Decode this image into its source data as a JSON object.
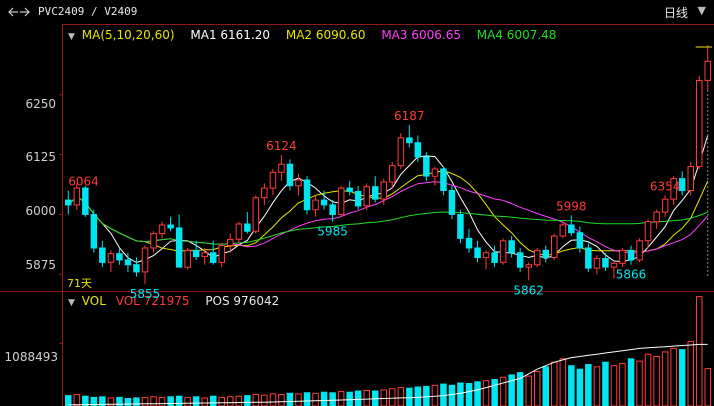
{
  "header": {
    "symbol": "PVC2409 / V2409",
    "period": "日线",
    "period_arrow": "▼"
  },
  "ma_legend": {
    "marker": "▼",
    "params": "MA(5,10,20,60)",
    "ma1": "MA1 6161.20",
    "ma2": "MA2 6090.60",
    "ma3": "MA3 6006.65",
    "ma4": "MA4 6007.48"
  },
  "vol_legend": {
    "marker": "▼",
    "name": "VOL",
    "vol": "VOL 721975",
    "pos": "POS 976042"
  },
  "colors": {
    "up": "#ff3a3a",
    "down": "#00e5f0",
    "ma1": "#ffffff",
    "ma2": "#e6e600",
    "ma3": "#ff40ff",
    "ma4": "#22dd22",
    "axis": "#8a1c1c"
  },
  "chart_data": [
    {
      "type": "candlestick",
      "y_ticks": [
        "6250",
        "6125",
        "6000",
        "5875"
      ],
      "y_tick_values": [
        6250,
        6125,
        6000,
        5875
      ],
      "ylim": [
        5838,
        6398
      ],
      "bar_count": 71,
      "bar_count_label": "71天",
      "annotations": [
        {
          "label": "6064",
          "index": 0,
          "kind": "high"
        },
        {
          "label": "5855",
          "index": 9,
          "kind": "low"
        },
        {
          "label": "6124",
          "index": 25,
          "kind": "high"
        },
        {
          "label": "5985",
          "index": 31,
          "kind": "low"
        },
        {
          "label": "6187",
          "index": 40,
          "kind": "high"
        },
        {
          "label": "5862",
          "index": 54,
          "kind": "low"
        },
        {
          "label": "5998",
          "index": 59,
          "kind": "high"
        },
        {
          "label": "5866",
          "index": 66,
          "kind": "low"
        },
        {
          "label": "6354",
          "index": 70,
          "kind": "high"
        }
      ],
      "candles": [
        [
          6030,
          6050,
          6000,
          6020
        ],
        [
          6020,
          6064,
          6010,
          6055
        ],
        [
          6055,
          6060,
          5995,
          6000
        ],
        [
          6000,
          6010,
          5920,
          5930
        ],
        [
          5930,
          5945,
          5890,
          5900
        ],
        [
          5900,
          5925,
          5880,
          5918
        ],
        [
          5918,
          5930,
          5895,
          5905
        ],
        [
          5905,
          5920,
          5880,
          5895
        ],
        [
          5895,
          5910,
          5870,
          5880
        ],
        [
          5880,
          5935,
          5855,
          5930
        ],
        [
          5930,
          5965,
          5920,
          5960
        ],
        [
          5960,
          5985,
          5950,
          5978
        ],
        [
          5978,
          5995,
          5965,
          5972
        ],
        [
          5972,
          6000,
          5900,
          5890
        ],
        [
          5890,
          5930,
          5885,
          5925
        ],
        [
          5925,
          5945,
          5905,
          5912
        ],
        [
          5912,
          5930,
          5895,
          5920
        ],
        [
          5920,
          5945,
          5895,
          5900
        ],
        [
          5900,
          5940,
          5890,
          5935
        ],
        [
          5935,
          5960,
          5920,
          5948
        ],
        [
          5948,
          5985,
          5940,
          5980
        ],
        [
          5980,
          6005,
          5960,
          5965
        ],
        [
          5965,
          6040,
          5960,
          6035
        ],
        [
          6035,
          6065,
          6020,
          6055
        ],
        [
          6055,
          6095,
          6040,
          6088
        ],
        [
          6088,
          6124,
          6070,
          6105
        ],
        [
          6105,
          6115,
          6050,
          6060
        ],
        [
          6060,
          6085,
          6040,
          6072
        ],
        [
          6072,
          6080,
          6000,
          6010
        ],
        [
          6010,
          6040,
          5995,
          6030
        ],
        [
          6030,
          6050,
          6010,
          6020
        ],
        [
          6020,
          6030,
          5985,
          6000
        ],
        [
          6000,
          6060,
          5995,
          6055
        ],
        [
          6055,
          6070,
          6040,
          6048
        ],
        [
          6048,
          6060,
          6010,
          6018
        ],
        [
          6018,
          6065,
          6010,
          6058
        ],
        [
          6058,
          6080,
          6025,
          6032
        ],
        [
          6032,
          6075,
          6020,
          6068
        ],
        [
          6068,
          6110,
          6055,
          6102
        ],
        [
          6102,
          6170,
          6095,
          6160
        ],
        [
          6160,
          6187,
          6140,
          6150
        ],
        [
          6150,
          6165,
          6110,
          6120
        ],
        [
          6120,
          6130,
          6070,
          6080
        ],
        [
          6080,
          6100,
          6060,
          6095
        ],
        [
          6095,
          6100,
          6040,
          6050
        ],
        [
          6050,
          6060,
          5990,
          6000
        ],
        [
          6000,
          6010,
          5940,
          5950
        ],
        [
          5950,
          5970,
          5920,
          5930
        ],
        [
          5930,
          5945,
          5900,
          5910
        ],
        [
          5910,
          5925,
          5885,
          5920
        ],
        [
          5920,
          5935,
          5890,
          5900
        ],
        [
          5900,
          5950,
          5895,
          5945
        ],
        [
          5945,
          5955,
          5910,
          5920
        ],
        [
          5920,
          5930,
          5880,
          5890
        ],
        [
          5890,
          5900,
          5862,
          5895
        ],
        [
          5895,
          5930,
          5890,
          5925
        ],
        [
          5925,
          5935,
          5900,
          5910
        ],
        [
          5910,
          5960,
          5905,
          5955
        ],
        [
          5955,
          5985,
          5950,
          5978
        ],
        [
          5978,
          5998,
          5955,
          5962
        ],
        [
          5962,
          5975,
          5920,
          5930
        ],
        [
          5930,
          5940,
          5880,
          5888
        ],
        [
          5888,
          5915,
          5875,
          5908
        ],
        [
          5908,
          5920,
          5882,
          5890
        ],
        [
          5890,
          5900,
          5866,
          5898
        ],
        [
          5898,
          5930,
          5890,
          5925
        ],
        [
          5925,
          5935,
          5895,
          5905
        ],
        [
          5905,
          5950,
          5900,
          5945
        ],
        [
          5945,
          5990,
          5930,
          5985
        ],
        [
          5985,
          6010,
          5970,
          6005
        ],
        [
          6005,
          6040,
          5995,
          6032
        ],
        [
          6032,
          6080,
          6020,
          6075
        ],
        [
          6075,
          6090,
          6040,
          6050
        ],
        [
          6050,
          6110,
          6040,
          6100
        ],
        [
          6100,
          6290,
          6095,
          6280
        ],
        [
          6280,
          6354,
          6260,
          6320
        ]
      ],
      "ma_series": [
        {
          "name": "MA1",
          "color": "#ffffff"
        },
        {
          "name": "MA2",
          "color": "#e6e600"
        },
        {
          "name": "MA3",
          "color": "#ff40ff"
        },
        {
          "name": "MA4",
          "color": "#22dd22"
        }
      ]
    },
    {
      "type": "bar",
      "y_ticks": [
        "1088493"
      ],
      "y_tick_values": [
        1088493
      ],
      "ylim": [
        0,
        1980000
      ],
      "volume": [
        180000,
        200000,
        170000,
        150000,
        160000,
        140000,
        150000,
        130000,
        140000,
        150000,
        160000,
        150000,
        160000,
        170000,
        150000,
        160000,
        140000,
        170000,
        150000,
        160000,
        170000,
        180000,
        200000,
        190000,
        210000,
        200000,
        220000,
        210000,
        230000,
        220000,
        240000,
        230000,
        250000,
        240000,
        260000,
        270000,
        260000,
        280000,
        300000,
        320000,
        310000,
        330000,
        340000,
        360000,
        380000,
        360000,
        400000,
        390000,
        420000,
        440000,
        460000,
        500000,
        540000,
        580000,
        520000,
        600000,
        680000,
        760000,
        820000,
        700000,
        640000,
        720000,
        680000,
        760000,
        700000,
        740000,
        820000,
        780000,
        900000,
        860000,
        940000,
        1000000,
        980000,
        1120000,
        1900000,
        650000
      ],
      "pos": [
        20000,
        22000,
        24000,
        26000,
        28000,
        30000,
        32000,
        34000,
        36000,
        38000,
        40000,
        42000,
        44000,
        46000,
        48000,
        50000,
        52000,
        54000,
        56000,
        58000,
        60000,
        62000,
        64000,
        66000,
        70000,
        74000,
        78000,
        82000,
        86000,
        90000,
        95000,
        100000,
        105000,
        110000,
        115000,
        120000,
        125000,
        130000,
        135000,
        140000,
        145000,
        150000,
        160000,
        170000,
        180000,
        200000,
        220000,
        250000,
        280000,
        320000,
        360000,
        400000,
        440000,
        480000,
        560000,
        640000,
        700000,
        760000,
        800000,
        840000,
        860000,
        880000,
        900000,
        920000,
        940000,
        960000,
        980000,
        1000000,
        1010000,
        1020000,
        1030000,
        1040000,
        1050000,
        1060000,
        1070000,
        1070000
      ]
    }
  ]
}
